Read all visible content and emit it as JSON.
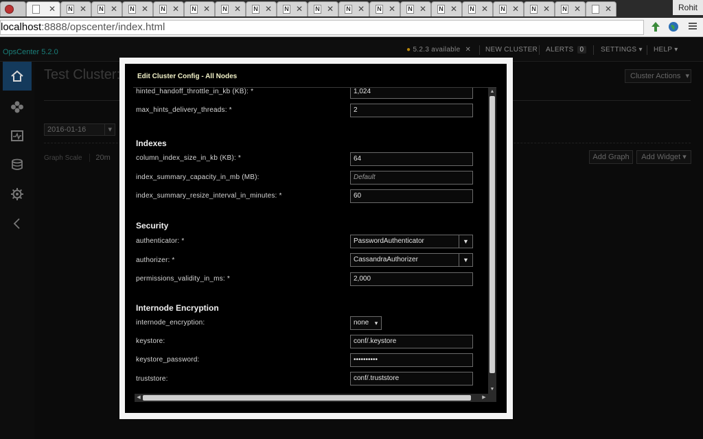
{
  "browser": {
    "tab_glyph": "N",
    "profile_name": "Rohit",
    "url_host": "localhost",
    "url_rest": ":8888/opscenter/index.html"
  },
  "app": {
    "brand": "OpsCenter 5.2.0",
    "nav": {
      "update": "5.2.3 available",
      "new_cluster": "NEW CLUSTER",
      "alerts": "ALERTS",
      "alerts_count": "0",
      "settings": "SETTINGS",
      "help": "HELP"
    },
    "page_title": "Test Cluster:",
    "cluster_actions": "Cluster Actions",
    "date": "2016-01-16",
    "graph_scale_label": "Graph Scale",
    "graph_scale_value": "20m",
    "add_graph": "Add Graph",
    "add_widget": "Add Widget"
  },
  "modal": {
    "title": "Edit Cluster Config - All Nodes",
    "fields": {
      "hinted_handoff": {
        "label": "hinted_handoff_throttle_in_kb (KB): *",
        "value": "1,024"
      },
      "max_hints": {
        "label": "max_hints_delivery_threads: *",
        "value": "2"
      },
      "column_index": {
        "label": "column_index_size_in_kb (KB): *",
        "value": "64"
      },
      "index_summary_capacity": {
        "label": "index_summary_capacity_in_mb (MB):",
        "placeholder": "Default"
      },
      "index_summary_resize": {
        "label": "index_summary_resize_interval_in_minutes: *",
        "value": "60"
      },
      "authenticator": {
        "label": "authenticator: *",
        "value": "PasswordAuthenticator"
      },
      "authorizer": {
        "label": "authorizer: *",
        "value": "CassandraAuthorizer"
      },
      "permissions_validity": {
        "label": "permissions_validity_in_ms: *",
        "value": "2,000"
      },
      "internode_encryption": {
        "label": "internode_encryption:",
        "value": "none"
      },
      "keystore": {
        "label": "keystore:",
        "value": "conf/.keystore"
      },
      "keystore_password": {
        "label": "keystore_password:",
        "value": "••••••••••"
      },
      "truststore": {
        "label": "truststore:",
        "value": "conf/.truststore"
      }
    },
    "sections": {
      "indexes": "Indexes",
      "security": "Security",
      "internode": "Internode Encryption"
    }
  },
  "colors": {
    "brand": "#1a7f7a",
    "sidebar_active": "#143a5c",
    "modal_title": "#f2f2c8"
  },
  "icons": {
    "home": "home-icon",
    "nodes": "nodes-icon",
    "dashboard": "dashboard-icon",
    "data": "database-icon",
    "settings": "gear-icon",
    "collapse": "chevron-left-icon"
  }
}
